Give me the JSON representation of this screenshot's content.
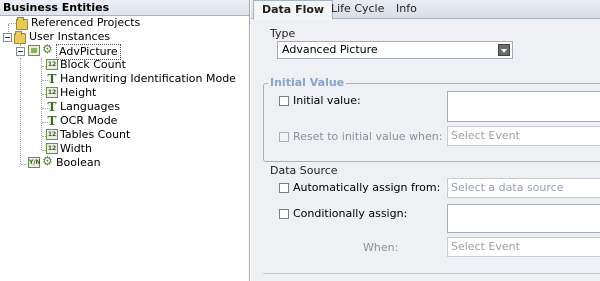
{
  "left_panel": {
    "title": "Business Entities",
    "nodes": [
      {
        "label": "Referenced Projects",
        "icon": "folder-icon"
      },
      {
        "label": "User Instances",
        "icon": "folder-icon"
      },
      {
        "label": "AdvPicture",
        "icon": "gears-icon"
      },
      {
        "label": "Block Count",
        "icon": "number-icon"
      },
      {
        "label": "Handwriting Identification Mode",
        "icon": "text-type-icon"
      },
      {
        "label": "Height",
        "icon": "number-icon"
      },
      {
        "label": "Languages",
        "icon": "text-type-icon"
      },
      {
        "label": "OCR Mode",
        "icon": "text-type-icon"
      },
      {
        "label": "Tables Count",
        "icon": "number-icon"
      },
      {
        "label": "Width",
        "icon": "number-icon"
      },
      {
        "label": "Boolean",
        "icon": "gears-icon"
      }
    ]
  },
  "tabs": [
    "Data Flow",
    "Life Cycle",
    "Info"
  ],
  "active_tab": "Data Flow",
  "type_section": {
    "title": "Type",
    "value": "Advanced Picture"
  },
  "initial_value": {
    "legend": "Initial Value",
    "initial_value_label": "Initial value:",
    "reset_label": "Reset to initial value when:",
    "reset_placeholder": "Select Event"
  },
  "data_source": {
    "title": "Data Source",
    "auto_label": "Automatically assign from:",
    "auto_placeholder": "Select a data source",
    "cond_label": "Conditionally assign:",
    "when_label": "When:",
    "when_placeholder": "Select Event"
  },
  "colors": {
    "legend": "#8aa3c8",
    "panel_bg": "#eef0f3"
  }
}
